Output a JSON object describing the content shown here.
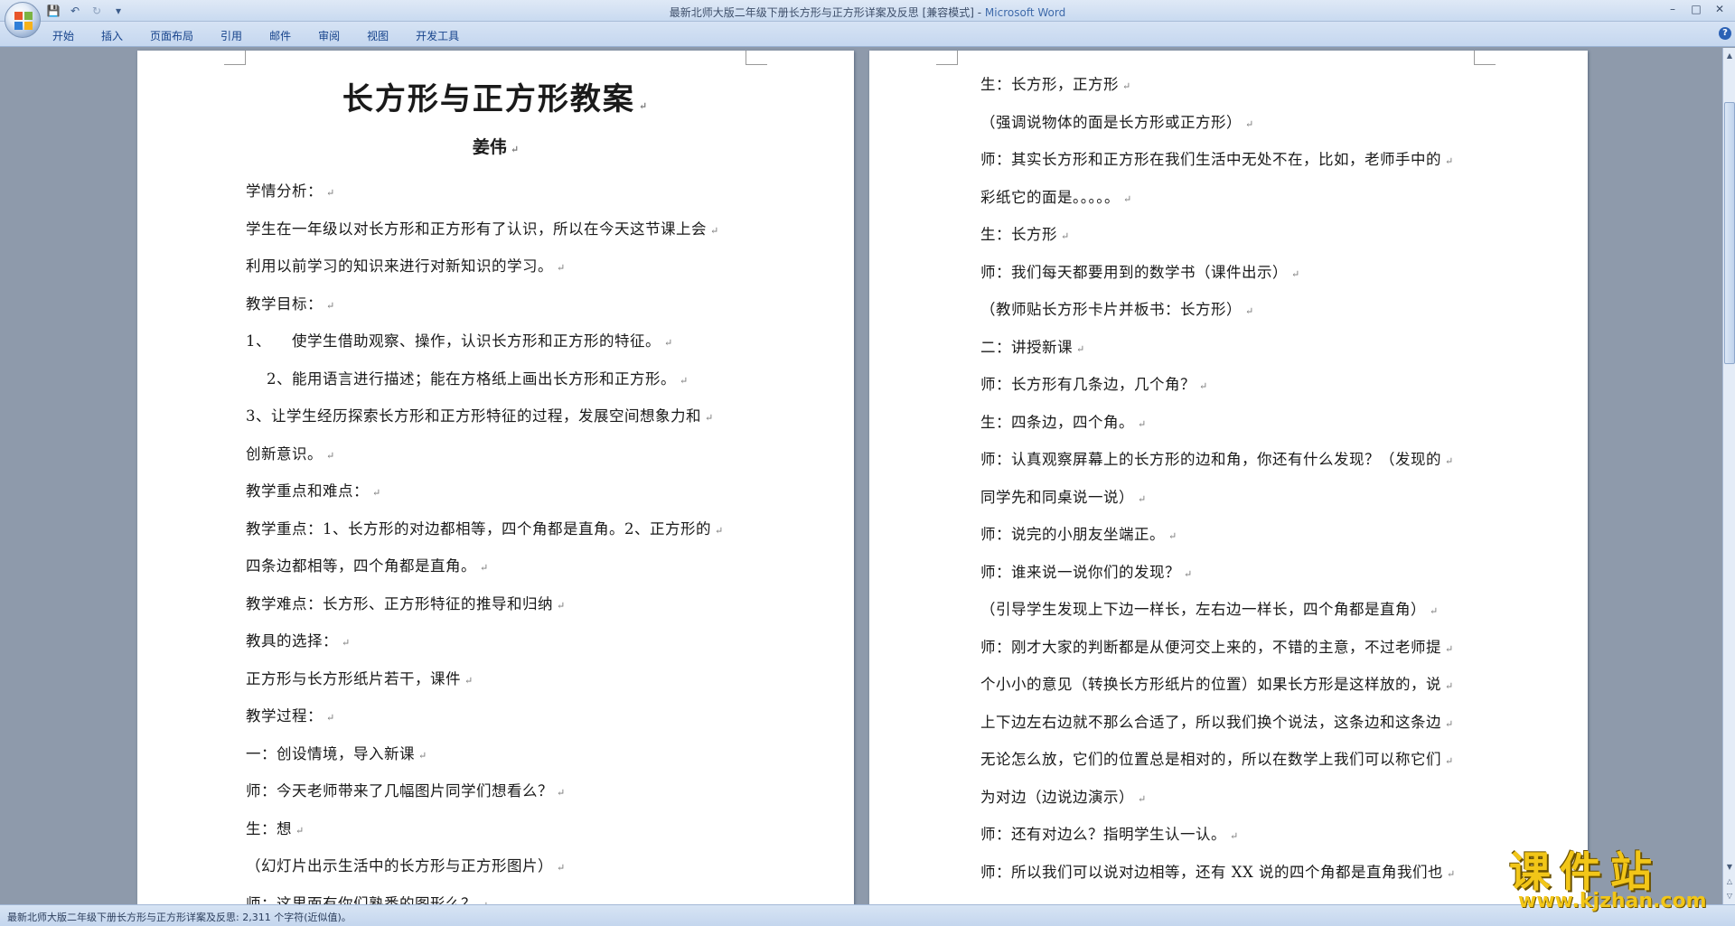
{
  "window": {
    "title": "最新北师大版二年级下册长方形与正方形详案及反思 [兼容模式] - ",
    "app_name": "Microsoft Word",
    "controls": [
      "–",
      "□",
      "✕"
    ]
  },
  "quick_access": {
    "icons": [
      "save-icon",
      "undo-icon",
      "redo-icon",
      "customize-icon"
    ]
  },
  "ribbon": {
    "tabs": [
      "开始",
      "插入",
      "页面布局",
      "引用",
      "邮件",
      "审阅",
      "视图",
      "开发工具"
    ],
    "help": "?"
  },
  "pilcrow": "↵",
  "document": {
    "title": "长方形与正方形教案",
    "author": "姜伟",
    "left_page": [
      "学情分析：",
      "学生在一年级以对长方形和正方形有了认识，所以在今天这节课上会",
      "利用以前学习的知识来进行对新知识的学习。",
      "教学目标：",
      "1、    使学生借助观察、操作，认识长方形和正方形的特征。",
      "    2、能用语言进行描述；能在方格纸上画出长方形和正方形。",
      "3、让学生经历探索长方形和正方形特征的过程，发展空间想象力和",
      "创新意识。",
      "教学重点和难点：",
      "教学重点：1、长方形的对边都相等，四个角都是直角。2、正方形的",
      "四条边都相等，四个角都是直角。",
      "教学难点：长方形、正方形特征的推导和归纳",
      "教具的选择：",
      "正方形与长方形纸片若干，课件",
      "教学过程：",
      "一：创设情境，导入新课",
      "师：今天老师带来了几幅图片同学们想看么？",
      "生：想",
      "（幻灯片出示生活中的长方形与正方形图片）",
      "师：这里面有你们熟悉的图形么？"
    ],
    "right_page": [
      "生：长方形，正方形",
      "（强调说物体的面是长方形或正方形）",
      "师：其实长方形和正方形在我们生活中无处不在，比如，老师手中的",
      "彩纸它的面是。。。。。",
      "生：长方形",
      "师：我们每天都要用到的数学书（课件出示）",
      "（教师贴长方形卡片并板书：长方形）",
      "二：讲授新课",
      "师：长方形有几条边，几个角？",
      "生：四条边，四个角。",
      "师：认真观察屏幕上的长方形的边和角，你还有什么发现？（发现的",
      "同学先和同桌说一说）",
      "师：说完的小朋友坐端正。",
      "师：谁来说一说你们的发现？",
      "（引导学生发现上下边一样长，左右边一样长，四个角都是直角）",
      "师：刚才大家的判断都是从便河交上来的，不错的主意，不过老师提",
      "个小小的意见（转换长方形纸片的位置）如果长方形是这样放的，说",
      "上下边左右边就不那么合适了，所以我们换个说法，这条边和这条边",
      "无论怎么放，它们的位置总是相对的，所以在数学上我们可以称它们",
      "为对边（边说边演示）",
      "师：还有对边么？指明学生认一认。",
      "师：所以我们可以说对边相等，还有 XX 说的四个角都是直角我们也"
    ]
  },
  "status_bar": {
    "text": "最新北师大版二年级下册长方形与正方形详案及反思: 2,311 个字符(近似值)。"
  },
  "watermark": {
    "name": "课件站",
    "url": "www.kjzhan.com"
  }
}
